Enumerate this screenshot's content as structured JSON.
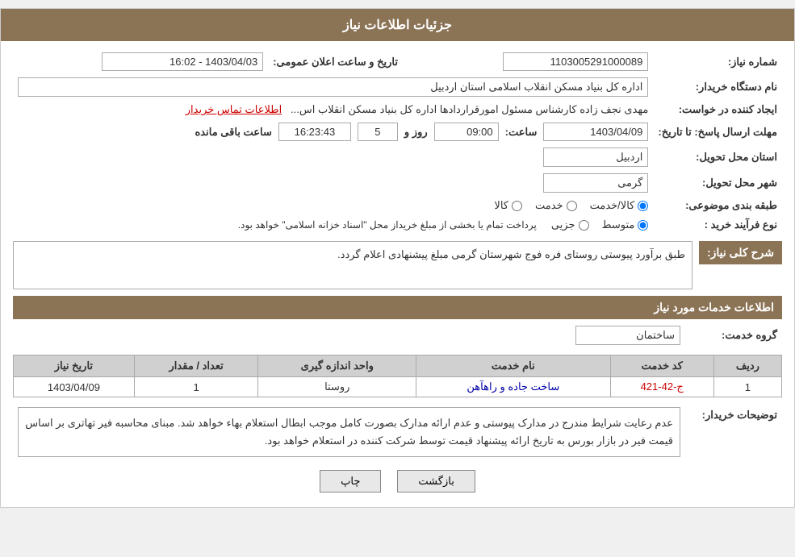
{
  "header": {
    "title": "جزئیات اطلاعات نیاز"
  },
  "main": {
    "need_number_label": "شماره نیاز:",
    "need_number_value": "1103005291000089",
    "buyer_org_label": "نام دستگاه خریدار:",
    "buyer_org_value": "اداره کل بنیاد مسکن انقلاب اسلامی استان اردبیل",
    "date_label": "تاریخ و ساعت اعلان عمومی:",
    "date_value": "1403/04/03 - 16:02",
    "creator_label": "ایجاد کننده در خواست:",
    "creator_value": "مهدی نجف زاده کارشناس مسئول امورقراردادها اداره کل بنیاد مسکن انقلاب اس...",
    "contact_link": "اطلاعات تماس خریدار",
    "deadline_label": "مهلت ارسال پاسخ: تا تاریخ:",
    "deadline_date": "1403/04/09",
    "deadline_time_label": "ساعت:",
    "deadline_time": "09:00",
    "deadline_day_label": "روز و",
    "deadline_days": "5",
    "deadline_remaining_label": "ساعت باقی مانده",
    "deadline_remaining": "16:23:43",
    "province_label": "استان محل تحویل:",
    "province_value": "اردبیل",
    "city_label": "شهر محل تحویل:",
    "city_value": "گرمی",
    "category_label": "طبقه بندی موضوعی:",
    "category_options": [
      "کالا",
      "خدمت",
      "کالا/خدمت"
    ],
    "category_selected": "کالا",
    "process_label": "نوع فرآیند خرید :",
    "process_options": [
      "جزیی",
      "متوسط"
    ],
    "process_note": "پرداخت تمام یا بخشی از مبلغ خریداز محل \"اسناد خزانه اسلامی\" خواهد بود.",
    "description_section": "شرح کلی نیاز:",
    "description_value": "طبق برآورد پیوستی روستای فره فوج شهرستان گرمی مبلغ پیشنهادی اعلام گردد.",
    "services_section": "اطلاعات خدمات مورد نیاز",
    "service_group_label": "گروه خدمت:",
    "service_group_value": "ساختمان",
    "table": {
      "columns": [
        "ردیف",
        "کد خدمت",
        "نام خدمت",
        "واحد اندازه گیری",
        "تعداد / مقدار",
        "تاریخ نیاز"
      ],
      "rows": [
        {
          "row_num": "1",
          "code": "ج-42-421",
          "name": "ساخت جاده و راهآهن",
          "unit": "روستا",
          "qty": "1",
          "date": "1403/04/09"
        }
      ]
    },
    "buyer_notes_label": "توضیحات خریدار:",
    "buyer_notes": "عدم رعایت شرایط مندرج در مدارک پیوستی و عدم ارائه مدارک بصورت کامل موجب ابطال استعلام بهاء خواهد شد. مبنای محاسبه فیر تهاتری بر اساس قیمت فیر در بازار بورس به تاریخ ارائه پیشنهاد قیمت توسط شرکت کننده در استعلام خواهد بود.",
    "btn_print": "چاپ",
    "btn_back": "بازگشت"
  }
}
